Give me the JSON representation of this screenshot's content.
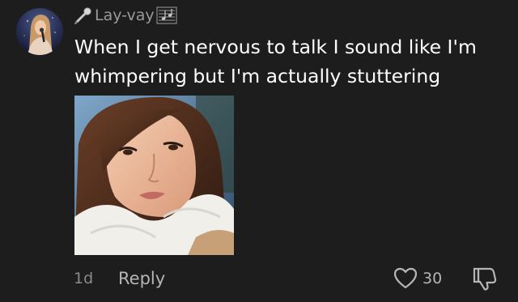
{
  "comment": {
    "username": "Lay-vay",
    "username_prefix_icon": "microphone-icon",
    "username_suffix_icon": "sheet-music-icon",
    "text": "When I get nervous to talk I sound like I'm whimpering but I'm actually stuttering",
    "age": "1d",
    "reply_label": "Reply",
    "like_count": "30"
  },
  "icons": {
    "like": "heart-outline-icon",
    "dislike": "thumbs-down-icon"
  },
  "colors": {
    "background": "#1d1d1d",
    "text": "#ffffff",
    "muted": "#8a8a8a"
  }
}
